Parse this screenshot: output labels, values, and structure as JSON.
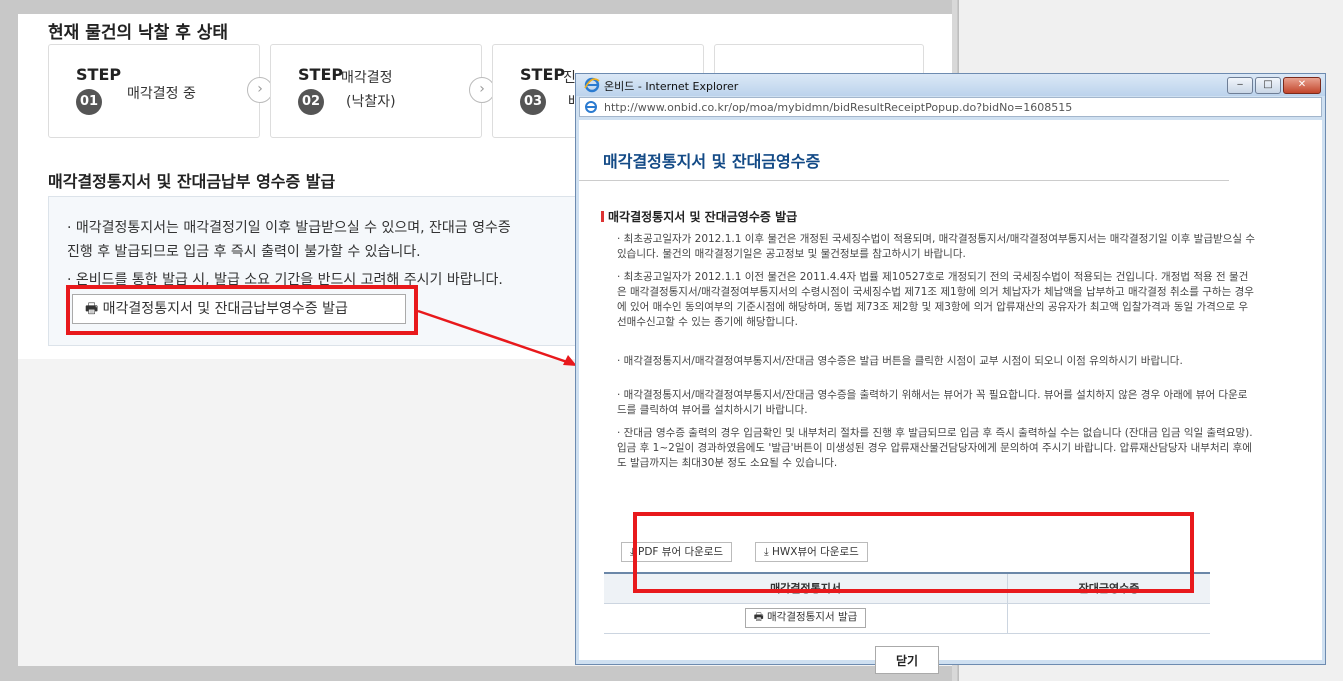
{
  "bg": {
    "section_title": "현재 물건의 낙찰 후 상태",
    "steps": [
      {
        "word": "STEP",
        "num": "01",
        "desc": "매각결정 중"
      },
      {
        "word": "STEP",
        "sub": "매각결정",
        "num": "02",
        "desc": "(낙찰자)"
      },
      {
        "word": "STEP",
        "sub": "진",
        "num": "03",
        "desc": "배"
      }
    ],
    "section2_title": "매각결정통지서 및 잔대금납부 영수증 발급",
    "info_lines": [
      "· 매각결정통지서는 매각결정기일 이후 발급받으실 수 있으며, 잔대금 영수증",
      "진행 후 발급되므로 입금 후 즉시 출력이 불가할 수 있습니다.",
      "· 온비드를 통한 발급 시, 발급 소요 기간을 반드시 고려해 주시기 바랍니다."
    ],
    "issue_button": "매각결정통지서 및 잔대금납부영수증 발급"
  },
  "popup": {
    "window_title": "온비드 - Internet Explorer",
    "url": "http://www.onbid.co.kr/op/moa/mybidmn/bidResultReceiptPopup.do?bidNo=1608515",
    "heading": "매각결정통지서 및 잔대금영수증",
    "subheading": "매각결정통지서 및 잔대금영수증 발급",
    "bullets": [
      "· 최초공고일자가 2012.1.1 이후 물건은 개정된 국세징수법이 적용되며, 매각결정통지서/매각결정여부통지서는 매각결정기일 이후 발급받으실 수 있습니다. 물건의 매각결정기일은 공고정보 및 물건정보를 참고하시기 바랍니다.",
      "· 최초공고일자가 2012.1.1 이전 물건은 2011.4.4자 법률 제10527호로 개정되기 전의 국세징수법이 적용되는 건입니다. 개정법 적용 전 물건은 매각결정통지서/매각결정여부통지서의 수령시점이 국세징수법 제71조 제1항에 의거 체납자가 체납액을 납부하고 매각결정 취소를 구하는 경우에 있어 매수인 동의여부의 기준시점에 해당하며, 동법 제73조 제2항 및 제3항에 의거 압류재산의 공유자가 최고액 입찰가격과 동일 가격으로 우선매수신고할 수 있는 종기에 해당합니다.",
      "· 매각결정통지서/매각결정여부통지서/잔대금 영수증은 발급 버튼을 클릭한 시점이 교부 시점이 되오니 이점 유의하시기 바랍니다.",
      "· 매각결정통지서/매각결정여부통지서/잔대금 영수증을 출력하기 위해서는 뷰어가 꼭 필요합니다. 뷰어를 설치하지 않은 경우 아래에 뷰어 다운로드를 클릭하여 뷰어를 설치하시기 바랍니다.",
      "· 잔대금 영수증 출력의 경우 입금확인 및 내부처리 절차를 진행 후 발급되므로 입금 후 즉시 출력하실 수는 없습니다 (잔대금 입금 익일 출력요망). 입금 후 1~2일이 경과하였음에도 '발급'버튼이 미생성된 경우 압류재산물건담당자에게 문의하여 주시기 바랍니다. 압류재산담당자 내부처리 후에도 발급까지는 최대30분 정도 소요될 수 있습니다."
    ],
    "pdf_button": "PDF 뷰어 다운로드",
    "hwx_button": "HWX뷰어 다운로드",
    "table": {
      "headers": [
        "매각결정통지서",
        "잔대금영수증"
      ],
      "notice_button": "매각결정통지서 발급"
    },
    "close_button": "닫기"
  },
  "colors": {
    "highlight": "#e8191c",
    "heading_blue": "#134a86"
  },
  "icons": [
    "print-icon",
    "download-icon",
    "ie-icon",
    "minimize-icon",
    "maximize-icon",
    "close-icon",
    "chevron-right-icon"
  ]
}
